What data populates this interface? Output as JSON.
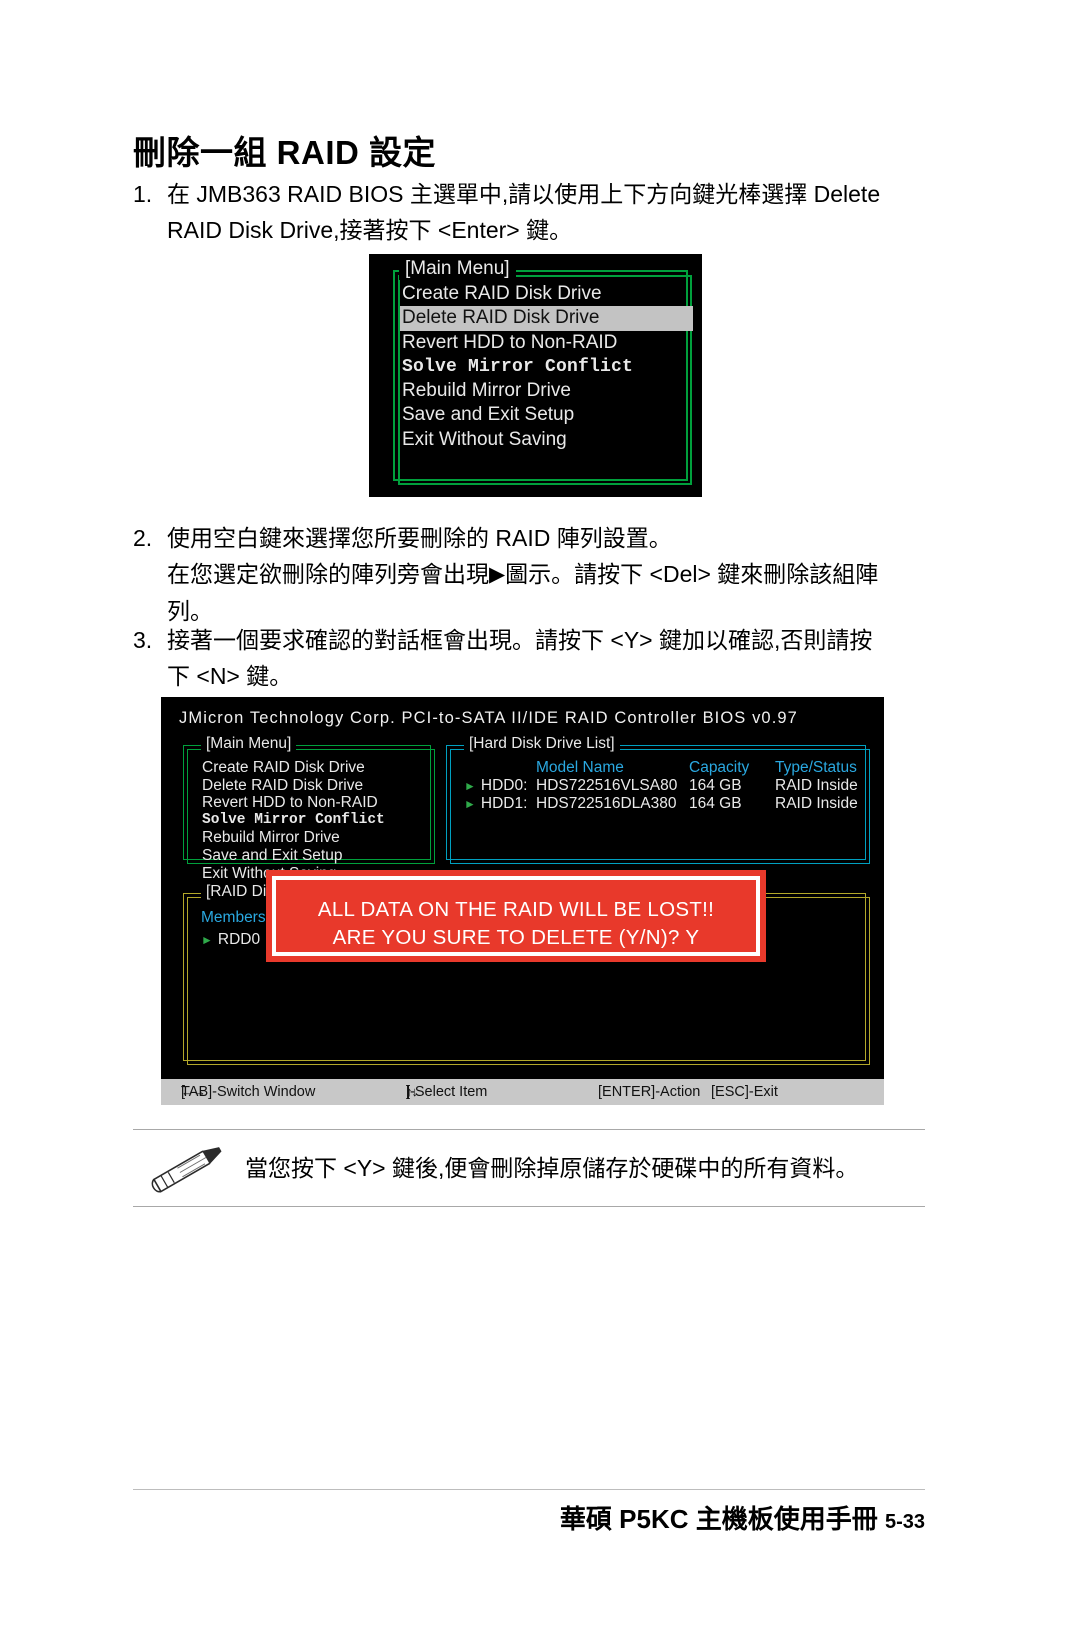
{
  "heading": "刪除一組 RAID 設定",
  "steps": [
    {
      "num": "1.",
      "line1_a": "在 JMB363 RAID BIOS 主選單中,請以使用上下方向鍵光棒選擇 Delete",
      "line1_b": "RAID Disk Drive,接著按下 <Enter> 鍵。"
    },
    {
      "num": "2.",
      "line1": "使用空白鍵來選擇您所要刪除的 RAID 陣列設置。",
      "line2_a": "在您選定欲刪除的陣列旁會出現",
      "line2_icon": "▶",
      "line2_b": "圖示。請按下 <Del> 鍵來刪除該組陣",
      "line3": "列。"
    },
    {
      "num": "3.",
      "line1": "接著一個要求確認的對話框會出現。請按下 <Y> 鍵加以確認,否則請按",
      "line2": "下 <N> 鍵。"
    }
  ],
  "bios_menu_screen": {
    "panel_title": "[Main Menu]",
    "highlighted": "Delete RAID Disk Drive",
    "items": [
      "Create RAID Disk Drive",
      "Delete RAID Disk Drive",
      "Revert HDD to Non-RAID",
      "Solve Mirror Conflict",
      "Rebuild Mirror Drive",
      "Save and Exit Setup",
      "Exit Without Saving"
    ]
  },
  "bios_main_screen": {
    "header": "JMicron Technology Corp. PCI-to-SATA II/IDE RAID Controller BIOS v0.97",
    "main_menu": {
      "title": "[Main Menu]",
      "items": [
        "Create RAID Disk Drive",
        "Delete RAID Disk Drive",
        "Revert HDD to Non-RAID",
        "Solve Mirror Conflict",
        "Rebuild Mirror Drive",
        "Save and Exit Setup",
        "Exit Without Saving"
      ]
    },
    "hard_disk_drive_list": {
      "title": "[Hard Disk Drive List]",
      "columns": [
        "",
        "Model Name",
        "Capacity",
        "Type/Status"
      ],
      "rows": [
        {
          "tag": "HDD0:",
          "model": "HDS722516VLSA80",
          "capacity": "164 GB",
          "status": "RAID Inside"
        },
        {
          "tag": "HDD1:",
          "model": "HDS722516DLA380",
          "capacity": "164 GB",
          "status": "RAID Inside"
        }
      ]
    },
    "raid_disk_drive_list": {
      "title": "[RAID Disk Drive List]",
      "column_header": "Members",
      "row_tag": "RDD0"
    },
    "dialog": {
      "line1": "ALL DATA ON THE RAID WILL BE LOST!!",
      "line2": "ARE YOU SURE TO DELETE (Y/N)? Y",
      "bg_color": "#e8392b",
      "text_color": "#ffffff"
    },
    "status_bar": {
      "switch_window": "TAB]-Switch Window",
      "switch_window_keys": "[",
      "switch_arrows": "←→",
      "select_item_open": "[",
      "select_arrows": "↑↓",
      "select_item": "]-Select Item",
      "enter_action": "[ENTER]-Action",
      "esc_exit": "[ESC]-Exit"
    }
  },
  "note": {
    "icon": "pencil-icon",
    "text": "當您按下 <Y> 鍵後,便會刪除掉原儲存於硬碟中的所有資料。"
  },
  "footer": {
    "title": "華碩 P5KC 主機板使用手冊",
    "page": "5-33"
  }
}
